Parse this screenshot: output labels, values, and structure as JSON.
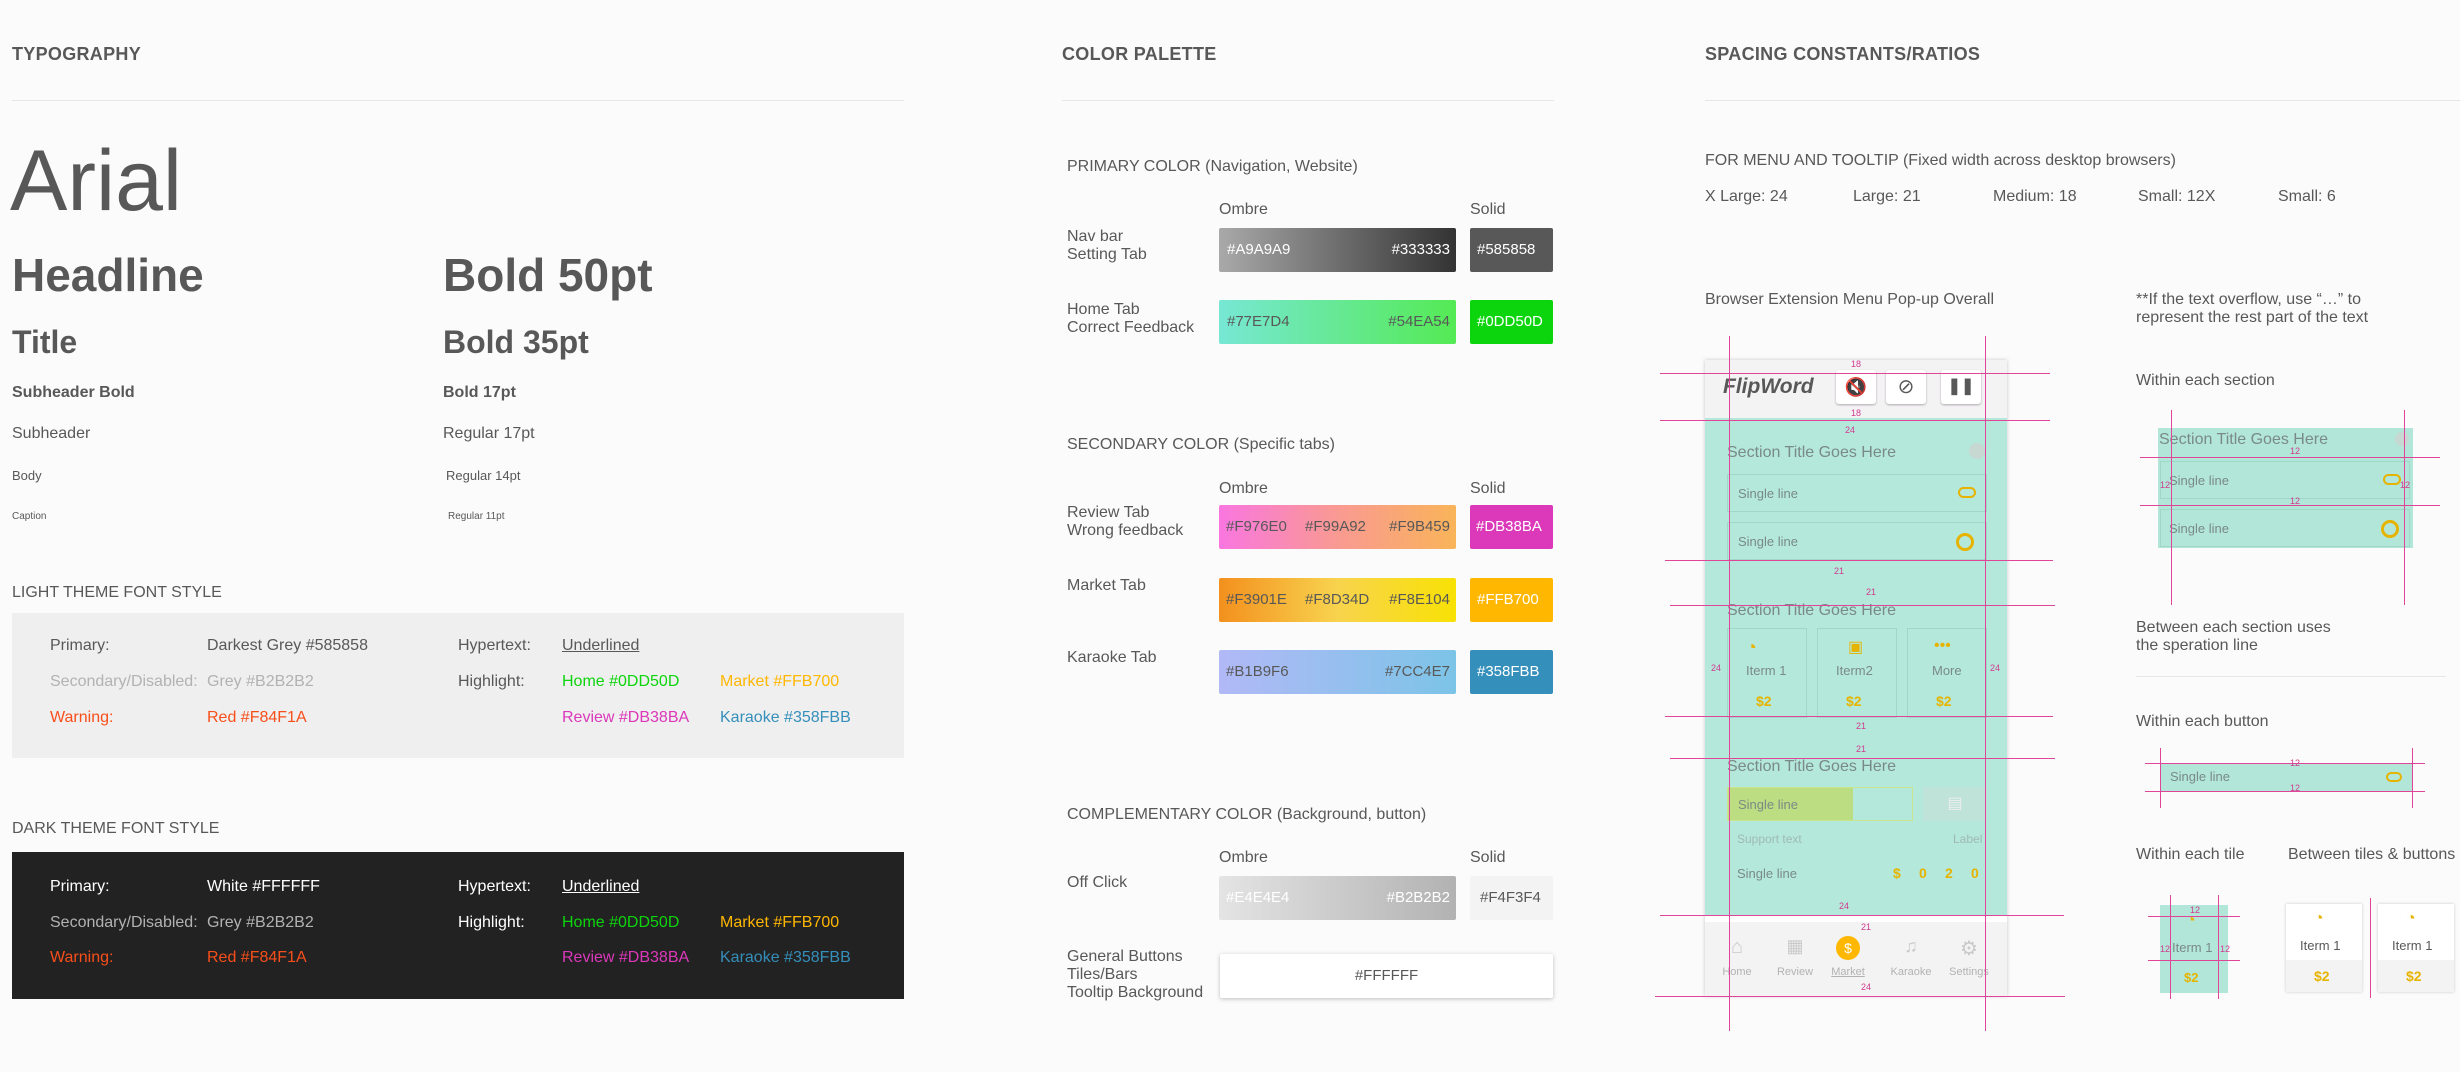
{
  "sections": {
    "typography": "TYPOGRAPHY",
    "palette": "COLOR PALETTE",
    "spacing": "SPACING CONSTANTS/RATIOS"
  },
  "typography": {
    "font": "Arial",
    "rows": [
      {
        "name": "Headline",
        "spec": "Bold 50pt"
      },
      {
        "name": "Title",
        "spec": "Bold 35pt"
      },
      {
        "name": "Subheader Bold",
        "spec": "Bold 17pt"
      },
      {
        "name": "Subheader",
        "spec": "Regular 17pt"
      },
      {
        "name": "Body",
        "spec": "Regular 14pt"
      },
      {
        "name": "Caption",
        "spec": "Regular 11pt"
      }
    ],
    "light": {
      "title": "LIGHT THEME FONT STYLE",
      "primary_label": "Primary:",
      "primary_value": "Darkest Grey #585858",
      "secondary_label": "Secondary/Disabled:",
      "secondary_value": "Grey #B2B2B2",
      "warning_label": "Warning:",
      "warning_value": "Red #F84F1A",
      "hyper_label": "Hypertext:",
      "hyper_value": "Underlined",
      "highlight_label": "Highlight:",
      "home": "Home #0DD50D",
      "market": "Market #FFB700",
      "review": "Review #DB38BA",
      "karaoke": "Karaoke #358FBB"
    },
    "dark": {
      "title": "DARK THEME FONT STYLE",
      "primary_label": "Primary:",
      "primary_value": "White #FFFFFF",
      "secondary_label": "Secondary/Disabled:",
      "secondary_value": "Grey #B2B2B2",
      "warning_label": "Warning:",
      "warning_value": "Red #F84F1A",
      "hyper_label": "Hypertext:",
      "hyper_value": "Underlined",
      "highlight_label": "Highlight:",
      "home": "Home #0DD50D",
      "market": "Market #FFB700",
      "review": "Review #DB38BA",
      "karaoke": "Karaoke #358FBB"
    }
  },
  "palette": {
    "primary": {
      "title": "PRIMARY COLOR (Navigation, Website)",
      "ombre": "Ombre",
      "solid": "Solid",
      "rows": [
        {
          "label": "Nav bar\nSetting Tab",
          "c1": "#A9A9A9",
          "c2": "#333333",
          "solid": "#585858"
        },
        {
          "label": "Home Tab\nCorrect Feedback",
          "c1": "#77E7D4",
          "c2": "#54EA54",
          "solid": "#0DD50D"
        }
      ]
    },
    "secondary": {
      "title": "SECONDARY COLOR (Specific tabs)",
      "ombre": "Ombre",
      "solid": "Solid",
      "rows": [
        {
          "label": "Review Tab\nWrong feedback",
          "c1": "#F976E0",
          "c2": "#F99A92",
          "c3": "#F9B459",
          "solid": "#DB38BA"
        },
        {
          "label": "Market Tab",
          "c1": "#F3901E",
          "c2": "#F8D34D",
          "c3": "#F8E104",
          "solid": "#FFB700"
        },
        {
          "label": "Karaoke Tab",
          "c1": "#B1B9F6",
          "c2": "#7CC4E7",
          "solid": "#358FBB"
        }
      ]
    },
    "complementary": {
      "title": "COMPLEMENTARY COLOR (Background, button)",
      "ombre": "Ombre",
      "solid": "Solid",
      "offclick": {
        "label": "Off Click",
        "c1": "#E4E4E4",
        "c2": "#B2B2B2",
        "solid": "#F4F3F4"
      },
      "general": {
        "label": "General Buttons\nTiles/Bars\nTooltip Background",
        "value": "#FFFFFF"
      }
    }
  },
  "spacing": {
    "menu_title": "FOR MENU AND TOOLTIP (Fixed width across desktop browsers)",
    "sizes": [
      "X Large: 24",
      "Large: 21",
      "Medium: 18",
      "Small: 12X",
      "Small: 6"
    ],
    "popup_title": "Browser Extension Menu Pop-up Overall",
    "overflow_note": "**If the text overflow, use “…” to represent the rest part of the text",
    "within_section": "Within each section",
    "between_sections": "Between each section uses the speration line",
    "within_button": "Within each button",
    "within_tile": "Within each tile",
    "between_tiles": "Between tiles & buttons",
    "mock": {
      "logo": "FlipWord",
      "section_title": "Section Title Goes Here",
      "single_line": "Single line",
      "support_text": "Support text",
      "label": "Label",
      "tiles": [
        "Iterm 1",
        "Iterm2",
        "More"
      ],
      "price": "$2",
      "digits": [
        "$",
        "0",
        "2",
        "0"
      ],
      "nav": [
        "Home",
        "Review",
        "Market",
        "Karaoke",
        "Settings"
      ],
      "tile_item": "Iterm 1",
      "nums": {
        "n18": "18",
        "n24": "24",
        "n21": "21",
        "n12": "12"
      }
    }
  },
  "colors": {
    "text": "#585858",
    "grey": "#B2B2B2",
    "red": "#F84F1A",
    "green": "#0DD50D",
    "yellow": "#FFB700",
    "pink": "#DB38BA",
    "blue": "#358FBB",
    "dark_bg": "#222222",
    "light_bg": "#EFEFEF"
  }
}
